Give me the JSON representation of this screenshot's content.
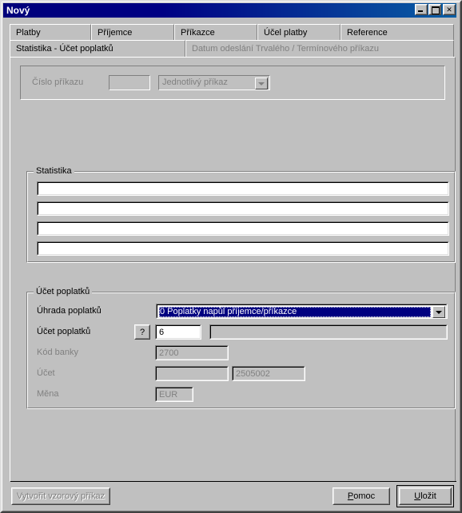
{
  "window": {
    "title": "Nový",
    "buttons": {
      "minimize": "minimize-icon",
      "maximize": "maximize-icon",
      "close": "✕"
    }
  },
  "tabs": {
    "row1": [
      {
        "label": "Platby",
        "enabled": true
      },
      {
        "label": "Příjemce",
        "enabled": true
      },
      {
        "label": "Příkazce",
        "enabled": true
      },
      {
        "label": "Účel platby",
        "enabled": true
      },
      {
        "label": "Reference",
        "enabled": true
      }
    ],
    "row2": [
      {
        "label": "Statistika - Účet poplatků",
        "enabled": true,
        "active": true
      },
      {
        "label": "Datum odeslání Trvalého / Termínového příkazu",
        "enabled": false,
        "active": false
      }
    ]
  },
  "order_number": {
    "label": "Číslo příkazu",
    "value": "",
    "type_value": "Jednotlivý příkaz",
    "type_options": [
      "Jednotlivý příkaz"
    ],
    "enabled": false
  },
  "statistika": {
    "group_label": "Statistika",
    "fields": [
      "",
      "",
      "",
      ""
    ]
  },
  "fee_account": {
    "group_label": "Účet poplatků",
    "payment_label": "Úhrada poplatků",
    "payment_value": "0 Poplatky napůl příjemce/příkazce",
    "payment_options": [
      "0 Poplatky napůl příjemce/příkazce"
    ],
    "account_label": "Účet poplatků",
    "help_button": "?",
    "account_code": "6",
    "account_name": "",
    "bank_code_label": "Kód banky",
    "bank_code_value": "2700",
    "account_row_label": "Účet",
    "account_prefix": "",
    "account_number": "2505002",
    "currency_label": "Měna",
    "currency_value": "EUR"
  },
  "footer": {
    "template_button": "Vytvořit vzorový příkaz",
    "help_button_pre": "P",
    "help_button_post": "omoc",
    "save_button_pre": "U",
    "save_button_post": "ložit"
  },
  "colors": {
    "title_bar_start": "#00007b",
    "title_bar_end": "#0a5fa5",
    "selection_bg": "#000080",
    "face": "#c0c0c0",
    "disabled_text": "#808080"
  }
}
